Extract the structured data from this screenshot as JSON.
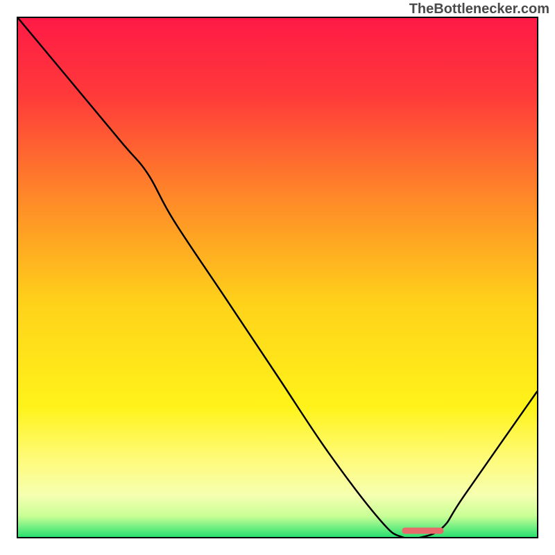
{
  "attribution": "TheBottlenecker.com",
  "chart_data": {
    "type": "line",
    "title": "",
    "xlabel": "",
    "ylabel": "",
    "xlim": [
      0,
      100
    ],
    "ylim": [
      0,
      100
    ],
    "x": [
      0,
      10,
      20,
      25,
      30,
      40,
      50,
      60,
      70,
      74,
      78,
      82,
      86,
      100
    ],
    "values": [
      100,
      88,
      76,
      70,
      61,
      46,
      31,
      16,
      3,
      0,
      0,
      2,
      8,
      28
    ],
    "gradient_stops": [
      {
        "offset": 0.0,
        "color": "#ff1a46"
      },
      {
        "offset": 0.15,
        "color": "#ff3a3a"
      },
      {
        "offset": 0.35,
        "color": "#ff8a28"
      },
      {
        "offset": 0.55,
        "color": "#ffd21a"
      },
      {
        "offset": 0.75,
        "color": "#fff31a"
      },
      {
        "offset": 0.85,
        "color": "#fffb7a"
      },
      {
        "offset": 0.92,
        "color": "#f5ffb0"
      },
      {
        "offset": 0.96,
        "color": "#c8ff96"
      },
      {
        "offset": 1.0,
        "color": "#28e070"
      }
    ],
    "marker": {
      "x_start": 74,
      "x_end": 82,
      "y": 1.2,
      "color": "#e86a6a"
    }
  }
}
